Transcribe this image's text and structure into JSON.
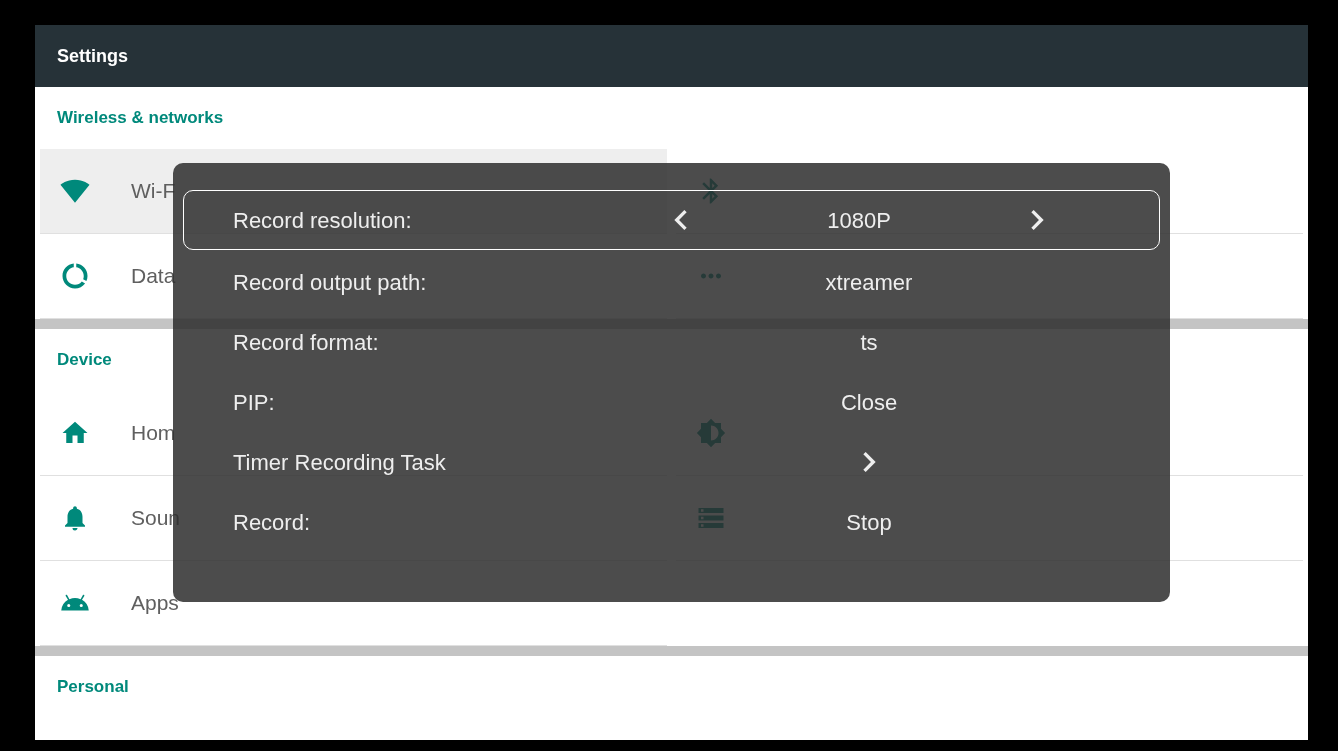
{
  "header": {
    "title": "Settings"
  },
  "sections": [
    {
      "title": "Wireless & networks",
      "items": [
        {
          "label": "Wi-F",
          "selected": true
        },
        {
          "label": "Data",
          "selected": false
        }
      ]
    },
    {
      "title": "Device",
      "items": [
        {
          "label": "Hom",
          "selected": false
        },
        {
          "label": "Soun",
          "selected": false
        },
        {
          "label": "Apps",
          "selected": false
        }
      ]
    },
    {
      "title": "Personal"
    }
  ],
  "dialog": {
    "rows": [
      {
        "label": "Record resolution:",
        "value": "1080P",
        "kind": "selector",
        "selected": true
      },
      {
        "label": "Record output path:",
        "value": "xtreamer",
        "kind": "value",
        "selected": false
      },
      {
        "label": "Record format:",
        "value": "ts",
        "kind": "value",
        "selected": false
      },
      {
        "label": "PIP:",
        "value": "Close",
        "kind": "value",
        "selected": false
      },
      {
        "label": "Timer Recording Task",
        "kind": "link",
        "selected": false
      },
      {
        "label": "Record:",
        "value": "Stop",
        "kind": "value",
        "selected": false
      }
    ]
  }
}
